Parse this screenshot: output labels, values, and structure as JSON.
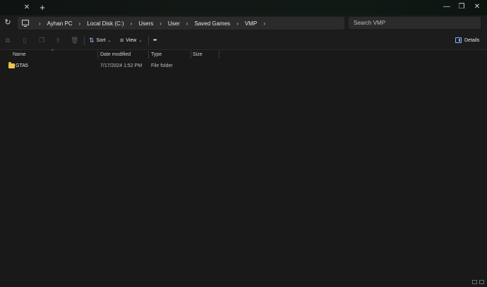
{
  "titlebar": {
    "close_tab_glyph": "✕",
    "new_tab_glyph": "+",
    "minimize_glyph": "—",
    "maximize_glyph": "❐",
    "close_glyph": "✕"
  },
  "nav": {
    "refresh_glyph": "↻",
    "breadcrumbs": [
      "Ayhan PC",
      "Local Disk (C:)",
      "Users",
      "User",
      "Saved Games",
      "VMP"
    ],
    "separator_glyph": "›",
    "search_placeholder": "Search VMP"
  },
  "command_bar": {
    "sort_label": "Sort",
    "view_label": "View",
    "more_glyph": "•••",
    "details_label": "Details"
  },
  "columns": {
    "name": "Name",
    "date_modified": "Date modified",
    "type": "Type",
    "size": "Size"
  },
  "files": [
    {
      "name": "GTA5",
      "date_modified": "7/17/2024 1:52 PM",
      "type": "File folder",
      "size": ""
    }
  ],
  "colors": {
    "background": "#191919",
    "address_bg": "#2b2b2b",
    "folder": "#f0c44a",
    "accent": "#7fb3ff"
  }
}
